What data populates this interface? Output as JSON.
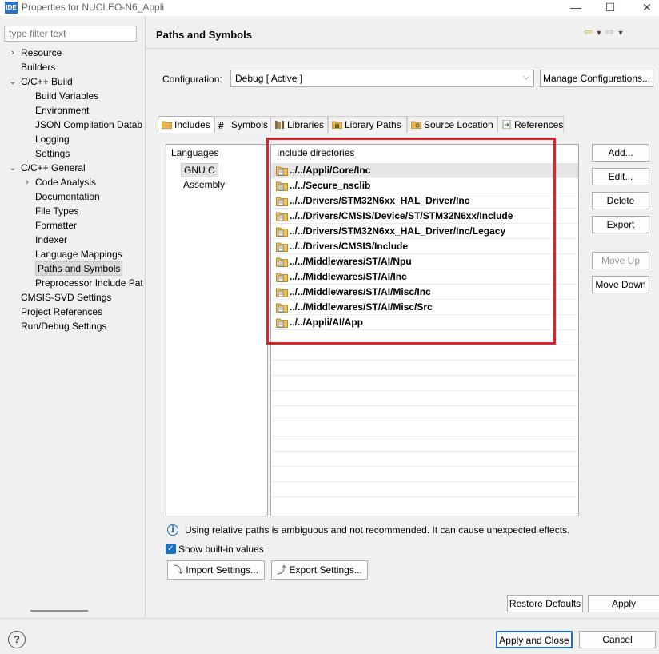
{
  "window": {
    "app_icon": "IDE",
    "title": "Properties for NUCLEO-N6_Appli",
    "minimize": "—",
    "maximize": "☐",
    "close": "✕"
  },
  "filter": {
    "placeholder": "type filter text"
  },
  "tree": [
    {
      "label": "Resource",
      "twisty": "›",
      "level": 0
    },
    {
      "label": "Builders",
      "twisty": "",
      "level": 0
    },
    {
      "label": "C/C++ Build",
      "twisty": "⌄",
      "level": 0
    },
    {
      "label": "Build Variables",
      "twisty": "",
      "level": 1
    },
    {
      "label": "Environment",
      "twisty": "",
      "level": 1
    },
    {
      "label": "JSON Compilation Datab",
      "twisty": "",
      "level": 1
    },
    {
      "label": "Logging",
      "twisty": "",
      "level": 1
    },
    {
      "label": "Settings",
      "twisty": "",
      "level": 1
    },
    {
      "label": "C/C++ General",
      "twisty": "⌄",
      "level": 0
    },
    {
      "label": "Code Analysis",
      "twisty": "›",
      "level": 1
    },
    {
      "label": "Documentation",
      "twisty": "",
      "level": 1
    },
    {
      "label": "File Types",
      "twisty": "",
      "level": 1
    },
    {
      "label": "Formatter",
      "twisty": "",
      "level": 1
    },
    {
      "label": "Indexer",
      "twisty": "",
      "level": 1
    },
    {
      "label": "Language Mappings",
      "twisty": "",
      "level": 1
    },
    {
      "label": "Paths and Symbols",
      "twisty": "",
      "level": 1,
      "selected": true
    },
    {
      "label": "Preprocessor Include Pat",
      "twisty": "",
      "level": 1
    },
    {
      "label": "CMSIS-SVD Settings",
      "twisty": "",
      "level": 0
    },
    {
      "label": "Project References",
      "twisty": "",
      "level": 0
    },
    {
      "label": "Run/Debug Settings",
      "twisty": "",
      "level": 0
    }
  ],
  "panel": {
    "title": "Paths and Symbols"
  },
  "configuration": {
    "label": "Configuration:",
    "value": "Debug  [ Active ]",
    "manage_button": "Manage Configurations..."
  },
  "tabs": [
    {
      "label": "Includes",
      "icon": "folder-include-icon",
      "active": true
    },
    {
      "label": "Symbols",
      "icon": "hash-icon"
    },
    {
      "label": "Libraries",
      "icon": "library-icon"
    },
    {
      "label": "Library Paths",
      "icon": "folder-library-icon"
    },
    {
      "label": "Source Location",
      "icon": "folder-source-icon"
    },
    {
      "label": "References",
      "icon": "reference-icon"
    }
  ],
  "languages": {
    "header": "Languages",
    "items": [
      "GNU C",
      "Assembly"
    ],
    "selected": "GNU C"
  },
  "includes": {
    "header": "Include directories",
    "items": [
      "../../Appli/Core/Inc",
      "../../Secure_nsclib",
      "../../Drivers/STM32N6xx_HAL_Driver/Inc",
      "../../Drivers/CMSIS/Device/ST/STM32N6xx/Include",
      "../../Drivers/STM32N6xx_HAL_Driver/Inc/Legacy",
      "../../Drivers/CMSIS/Include",
      "../../Middlewares/ST/AI/Npu",
      "../../Middlewares/ST/AI/Inc",
      "../../Middlewares/ST/AI/Misc/Inc",
      "../../Middlewares/ST/AI/Misc/Src",
      "../../Appli/AI/App"
    ],
    "selected_index": 0
  },
  "side_buttons": {
    "add": "Add...",
    "edit": "Edit...",
    "delete": "Delete",
    "export": "Export",
    "move_up": "Move Up",
    "move_down": "Move Down"
  },
  "info_text": "Using relative paths is ambiguous and not recommended. It can cause unexpected effects.",
  "show_builtin": {
    "label": "Show built-in values",
    "checked": true
  },
  "import_button": "Import Settings...",
  "export_button": "Export Settings...",
  "restore_defaults": "Restore Defaults",
  "apply": "Apply",
  "apply_and_close": "Apply and Close",
  "cancel": "Cancel",
  "help": "?"
}
